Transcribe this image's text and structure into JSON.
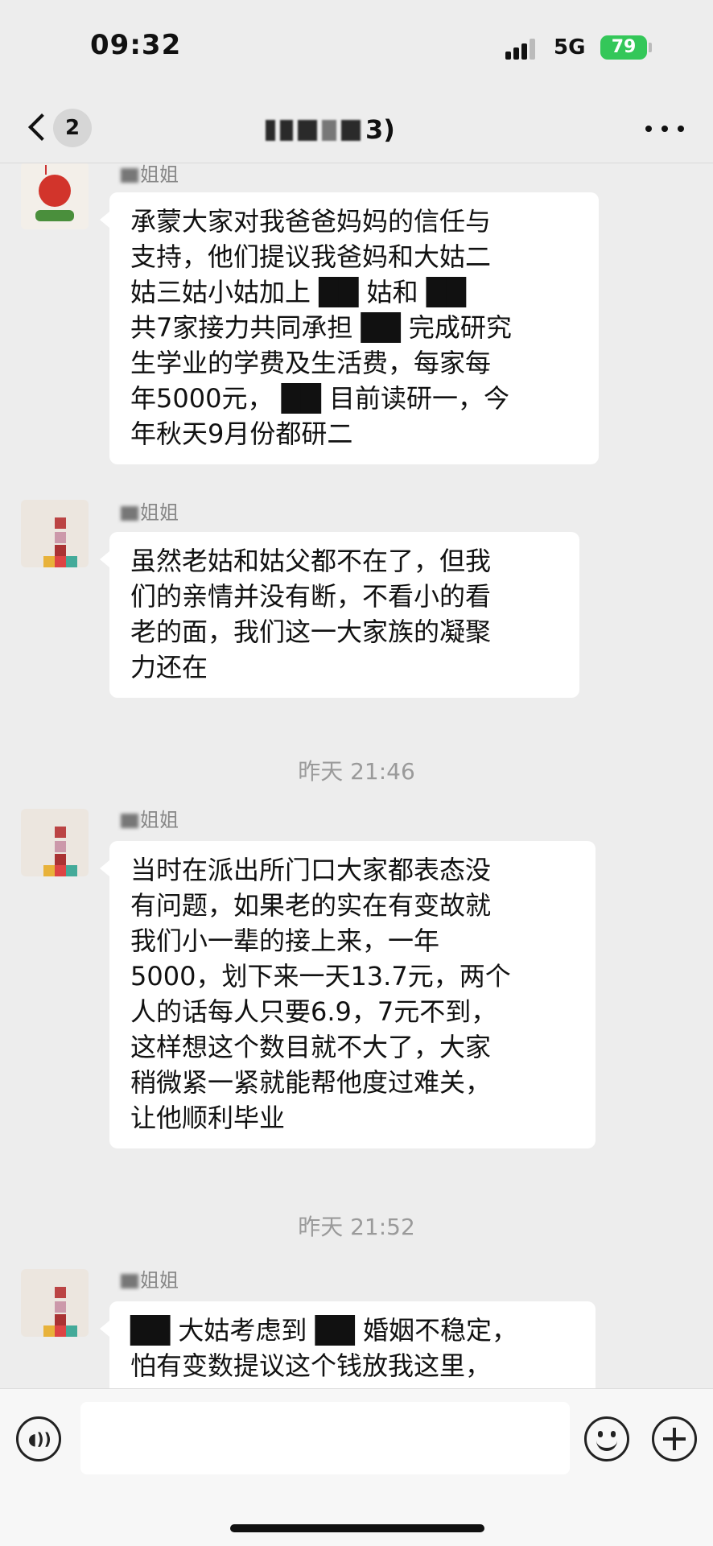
{
  "status_bar": {
    "time": "09:32",
    "network": "5G",
    "battery": "79"
  },
  "nav": {
    "unread_count": "2",
    "title_suffix": "3)"
  },
  "messages": [
    {
      "sender_suffix": "姐姐",
      "text": "承蒙大家对我爸爸妈妈的信任与\n支持，他们提议我爸妈和大姑二\n姑三姑小姑加上 ██ 姑和 ██\n共7家接力共同承担 ██ 完成研究\n生学业的学费及生活费，每家每\n年5000元， ██ 目前读研一，今\n年秋天9月份都研二"
    },
    {
      "sender_suffix": "姐姐",
      "text": "虽然老姑和姑父都不在了，但我\n们的亲情并没有断，不看小的看\n老的面，我们这一大家族的凝聚\n力还在"
    },
    {
      "sender_suffix": "姐姐",
      "text": "当时在派出所门口大家都表态没\n有问题，如果老的实在有变故就\n我们小一辈的接上来，一年\n5000，划下来一天13.7元，两个\n人的话每人只要6.9，7元不到，\n这样想这个数目就不大了，大家\n稍微紧一紧就能帮他度过难关，\n让他顺利毕业"
    },
    {
      "sender_suffix": "姐姐",
      "text": "██ 大姑考虑到 ██ 婚姻不稳定，\n怕有变数提议这个钱放我这里，"
    }
  ],
  "timestamps": [
    "昨天 21:46",
    "昨天 21:52"
  ],
  "input": {
    "placeholder": ""
  },
  "icons": {
    "back": "back-chevron-icon",
    "more": "more-dots-icon",
    "voice": "voice-icon",
    "emoji": "emoji-icon",
    "add": "add-icon"
  },
  "colors": {
    "background": "#ededed",
    "bubble": "#ffffff",
    "battery": "#34c759"
  }
}
